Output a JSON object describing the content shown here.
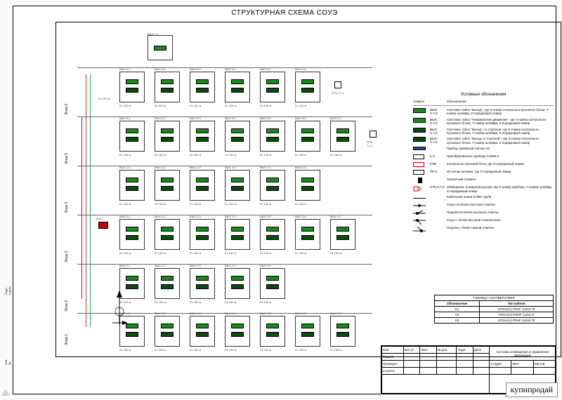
{
  "title": "СТРУКТУРНАЯ СХЕМА СОУЭ",
  "legend": {
    "heading": "Условные обозначения",
    "col_symbol": "Символ",
    "col_desc": "Обозначение",
    "items": [
      {
        "symClass": "tag",
        "code": "ВЫХ. Х.Y.Z",
        "desc": "Световое табло \"Выход\", где Х-номер контрольно-пускового блока, Y-номер шлейфа, Z-порядковый номер"
      },
      {
        "symClass": "tag",
        "code": "ВЫХ. Х.Y.Z",
        "desc": "Световое табло \"Направление движения\", где Х-номер контрольно-пускового блока, Y-номер шлейфа, Z-порядковый номер"
      },
      {
        "symClass": "tag dark",
        "code": "ВЫХ. Х.Y.Z",
        "desc": "Световое табло \"Выход\" со стрелкой, где Х-номер контрольно-пускового блока, Y-номер шлейфа, Z-порядковый номер"
      },
      {
        "symClass": "tag dark",
        "code": "ВЫХ. Х.Y.Z",
        "desc": "Световое табло \"Выход со стрелкой\", где Х-номер контрольно-пускового блока, Y-номер шлейфа, Z-порядковый номер"
      },
      {
        "symClass": "bluebar",
        "code": "",
        "desc": "Прибор приёмный Сигнал-10"
      },
      {
        "symClass": "whitebox",
        "code": "К-Х",
        "desc": "Преобразователь прибора С2000-4"
      },
      {
        "symClass": "redbox",
        "code": "КПБ",
        "desc": "Контрольно-пусковой блок, где Х-порядковый номер"
      },
      {
        "symClass": "whitebox",
        "code": "ПК-Х",
        "desc": "Источник питания, где Х-порядковый номер"
      },
      {
        "symClass": "blackbox",
        "code": "",
        "desc": "Оконечный элемент"
      },
      {
        "symClass": "icon-speaker",
        "code": "STN.Х.Y.Z",
        "desc": "Извещатель пожарный ручной, где Х-номер прибора, Y-номер шлейфа, Z-порядковый номер"
      },
      {
        "symClass": "line",
        "code": "",
        "desc": "Кабельная линия в ПВХ трубе"
      },
      {
        "symClass": "dot",
        "code": "",
        "desc": "Спуск по более высокой отметке"
      },
      {
        "symClass": "dot-slash",
        "code": "",
        "desc": "Подъём на более высокую отметку"
      },
      {
        "symClass": "dot-down",
        "code": "",
        "desc": "Спуск с более высокой отметки вниз"
      },
      {
        "symClass": "dot-up",
        "code": "",
        "desc": "Подъём с более низкой отметки"
      }
    ]
  },
  "corr_table": {
    "title": "ТАБЛИЦА СООТВЕТСТВИЯ",
    "headers": [
      "Обозначение",
      "Тип кабеля"
    ],
    "rows": [
      [
        "К1",
        "КПСнг(А)-FRHF 1x2x0,75"
      ],
      [
        "К2",
        "КПСнг(А)-FRHF 1x2x1,5"
      ],
      [
        "К3",
        "КПСнг(А)-FRHF 2x2x0,75"
      ]
    ]
  },
  "floors": [
    "Этаж 6",
    "Этаж 5",
    "Этаж 4",
    "Этаж 3",
    "Этаж 2",
    "Этаж 1"
  ],
  "floor_devices": {
    "top_isolated": {
      "label": "ВЫХ 7.1"
    },
    "row1": [
      "ВЫХ 6.1",
      "ВЫХ 6.2",
      "ВЫХ 6.3",
      "ВЫХ 6.4",
      "ВЫХ 6.5",
      "ВЫХ 6.6"
    ],
    "row1_right": "STN 7.2.1",
    "row2": [
      "ВЫХ 5.1",
      "ВЫХ 5.2",
      "ВЫХ 5.3",
      "ВЫХ 5.4",
      "ВЫХ 5.5",
      "ВЫХ 5.6",
      "ВЫХ 5.7"
    ],
    "row2_right": "STN 7.1.1",
    "row3": [
      "ВЫХ 4.1",
      "ВЫХ 4.2",
      "ВЫХ 4.3",
      "ВЫХ 4.4",
      "ВЫХ 4.5",
      "ВЫХ 4.6"
    ],
    "row4": [
      "ВЫХ 3.1",
      "ВЫХ 3.2",
      "ВЫХ 3.3",
      "ВЫХ 3.4",
      "ВЫХ 3.5",
      "ВЫХ 3.6",
      "ВЫХ 3.7"
    ],
    "row4_left": "КПБ-1",
    "row5": [
      "ВЫХ 2.1",
      "ВЫХ 2.2",
      "ВЫХ 2.3",
      "ВЫХ 2.4",
      "ВЫХ 2.5"
    ],
    "row6": [
      "ВЫХ 1.1",
      "ВЫХ 1.2",
      "ВЫХ 1.3",
      "ВЫХ 1.4",
      "ВЫХ 1.5",
      "ВЫХ 1.6",
      "ВЫХ 1.7"
    ]
  },
  "dimensions_hint": "К1 150 м",
  "title_block": {
    "cells": {
      "r1": [
        "Изм.",
        "Кол.уч",
        "Лист",
        "№ док.",
        "Подп.",
        "Дата"
      ],
      "r2_left": [
        "Разраб.",
        "",
        "",
        ""
      ],
      "r2_right": "Система оповещения и управления эвакуацией",
      "r3_left": [
        "Проверил",
        "",
        "",
        ""
      ],
      "r4_left": [
        "Н.контр.",
        "",
        "",
        ""
      ],
      "stage": "Стадия",
      "sheet": "Лист",
      "sheets": "Листов"
    }
  },
  "watermark": "купипродай"
}
